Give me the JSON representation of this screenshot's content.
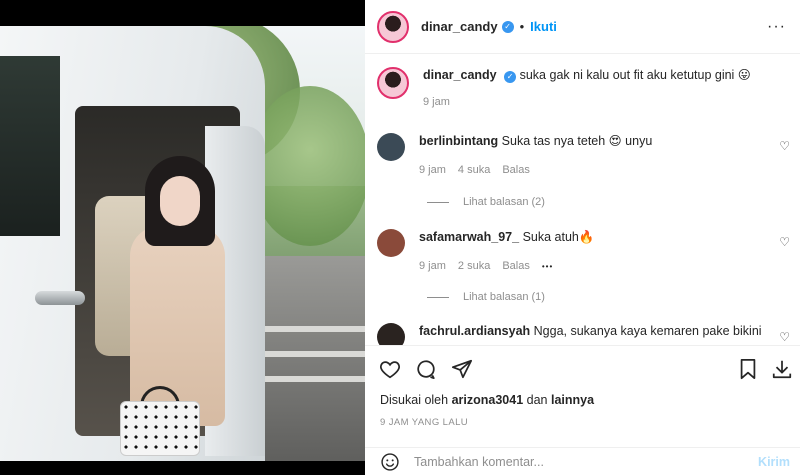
{
  "header": {
    "username": "dinar_candy",
    "verified_mark": "✓",
    "follow_label": "Ikuti",
    "more_label": "···"
  },
  "caption": {
    "username": "dinar_candy",
    "text": "suka gak ni kalu out fit aku ketutup gini 😛",
    "time": "9 jam"
  },
  "comments": [
    {
      "username": "berlinbintang",
      "text": "Suka tas nya teteh 😍 unyu",
      "time": "9 jam",
      "likes": "4 suka",
      "reply": "Balas",
      "view_replies": "Lihat balasan (2)",
      "avatar_color": "#3b4a56"
    },
    {
      "username": "safamarwah_97_",
      "text": "Suka atuh🔥",
      "time": "9 jam",
      "likes": "2 suka",
      "reply": "Balas",
      "more": "•••",
      "view_replies": "Lihat balasan (1)",
      "avatar_color": "#8a4a3a"
    },
    {
      "username": "fachrul.ardiansyah",
      "text": "Ngga, sukanya kaya kemaren pake bikini",
      "avatar_color": "#2a2320"
    }
  ],
  "actions": {
    "liked_by_prefix": "Disukai oleh",
    "liked_by_user": "arizona3041",
    "liked_by_and": "dan",
    "liked_by_others": "lainnya",
    "timestamp": "9 JAM YANG LALU"
  },
  "add_comment": {
    "placeholder": "Tambahkan komentar...",
    "post_label": "Kirim"
  },
  "colors": {
    "accent": "#0095f6",
    "muted": "#8e8e8e",
    "post_disabled": "#b2dffc"
  }
}
